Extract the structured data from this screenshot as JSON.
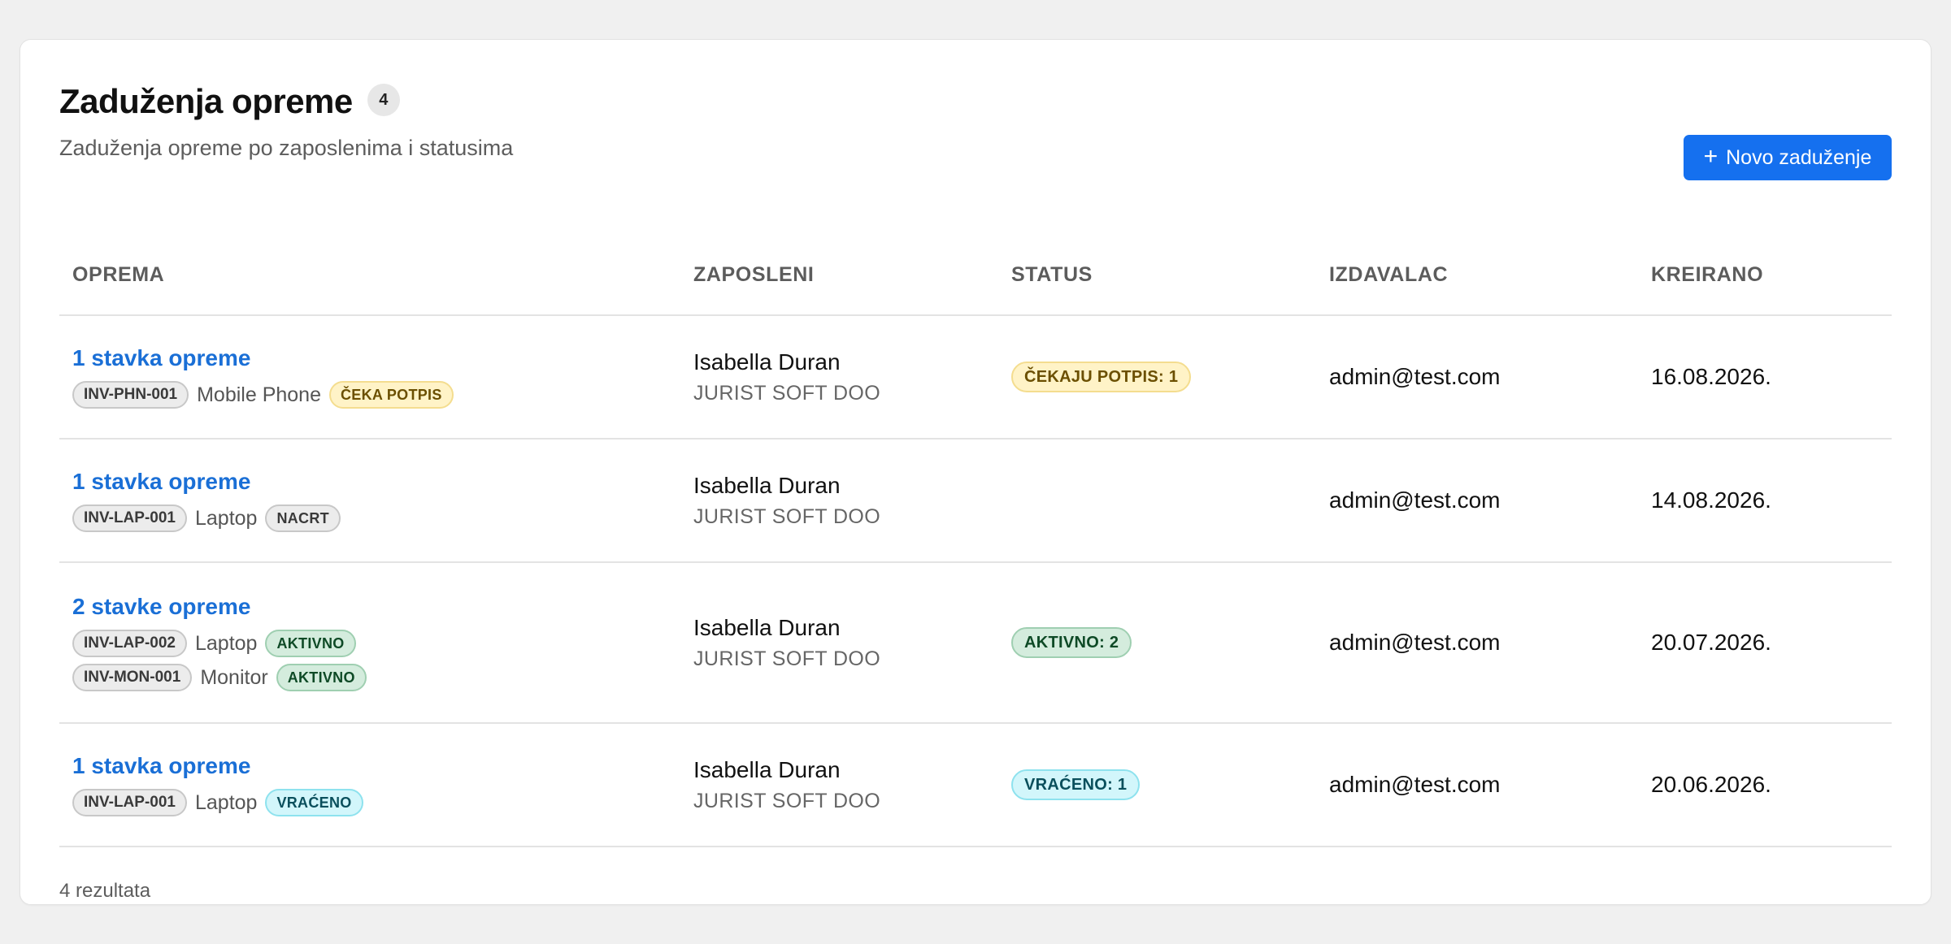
{
  "header": {
    "title": "Zaduženja opreme",
    "count": "4",
    "subtitle": "Zaduženja opreme po zaposlenima i statusima",
    "new_button_label": "Novo zaduženje",
    "new_button_icon": "plus-icon"
  },
  "table": {
    "columns": [
      "OPREMA",
      "ZAPOSLENI",
      "STATUS",
      "IZDAVALAC",
      "KREIRANO"
    ],
    "rows": [
      {
        "title": "1 stavka opreme",
        "items": [
          {
            "code": "INV-PHN-001",
            "name": "Mobile Phone",
            "state": "ČEKA POTPIS"
          }
        ],
        "employee": "Isabella Duran",
        "company": "JURIST SOFT DOO",
        "status": "ČEKAJU POTPIS: 1",
        "issuer": "admin@test.com",
        "created": "16.08.2026."
      },
      {
        "title": "1 stavka opreme",
        "items": [
          {
            "code": "INV-LAP-001",
            "name": "Laptop",
            "state": "NACRT"
          }
        ],
        "employee": "Isabella Duran",
        "company": "JURIST SOFT DOO",
        "status": "",
        "issuer": "admin@test.com",
        "created": "14.08.2026."
      },
      {
        "title": "2 stavke opreme",
        "items": [
          {
            "code": "INV-LAP-002",
            "name": "Laptop",
            "state": "AKTIVNO"
          },
          {
            "code": "INV-MON-001",
            "name": "Monitor",
            "state": "AKTIVNO"
          }
        ],
        "employee": "Isabella Duran",
        "company": "JURIST SOFT DOO",
        "status": "AKTIVNO: 2",
        "issuer": "admin@test.com",
        "created": "20.07.2026."
      },
      {
        "title": "1 stavka opreme",
        "items": [
          {
            "code": "INV-LAP-001",
            "name": "Laptop",
            "state": "VRAĆENO"
          }
        ],
        "employee": "Isabella Duran",
        "company": "JURIST SOFT DOO",
        "status": "VRAĆENO: 1",
        "issuer": "admin@test.com",
        "created": "20.06.2026."
      }
    ]
  },
  "footer": {
    "results": "4 rezultata"
  },
  "colors": {
    "primary": "#1570ef",
    "link": "#1a6fd6",
    "yellow": "#fff3c7",
    "green": "#d4ecdd",
    "cyan": "#d2f6fb",
    "gray": "#ececec"
  }
}
